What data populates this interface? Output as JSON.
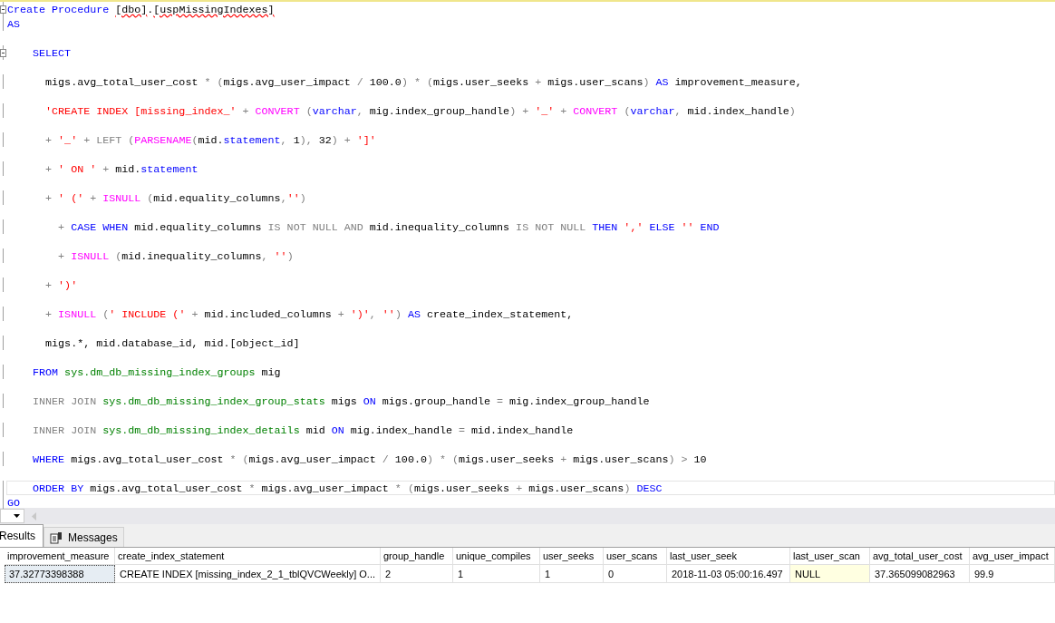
{
  "editor": {
    "lines": [
      {
        "collapsible": true,
        "blank_before": false,
        "current": false,
        "tokens": [
          {
            "kind": "keyword",
            "text": "Create Procedure "
          },
          {
            "kind": "error",
            "text": "[dbo]"
          },
          {
            "kind": "plain",
            "text": "."
          },
          {
            "kind": "error",
            "text": "[uspMissingIndexes]"
          }
        ]
      },
      {
        "collapsible": false,
        "blank_before": false,
        "current": false,
        "tokens": [
          {
            "kind": "keyword",
            "text": "AS"
          }
        ]
      },
      {
        "collapsible": true,
        "blank_before": true,
        "current": false,
        "tokens": [
          {
            "kind": "keyword",
            "text": "    SELECT"
          }
        ]
      },
      {
        "collapsible": false,
        "blank_before": true,
        "current": false,
        "tokens": [
          {
            "kind": "plain",
            "text": "      migs.avg_total_user_cost "
          },
          {
            "kind": "gray",
            "text": "* ("
          },
          {
            "kind": "plain",
            "text": "migs.avg_user_impact "
          },
          {
            "kind": "gray",
            "text": "/"
          },
          {
            "kind": "plain",
            "text": " 100.0"
          },
          {
            "kind": "gray",
            "text": ") * ("
          },
          {
            "kind": "plain",
            "text": "migs.user_seeks "
          },
          {
            "kind": "gray",
            "text": "+"
          },
          {
            "kind": "plain",
            "text": " migs.user_scans"
          },
          {
            "kind": "gray",
            "text": ")"
          },
          {
            "kind": "keyword",
            "text": " AS"
          },
          {
            "kind": "plain",
            "text": " improvement_measure,"
          }
        ]
      },
      {
        "collapsible": false,
        "blank_before": true,
        "current": false,
        "tokens": [
          {
            "kind": "string",
            "text": "      'CREATE INDEX [missing_index_'"
          },
          {
            "kind": "gray",
            "text": " +"
          },
          {
            "kind": "function",
            "text": " CONVERT"
          },
          {
            "kind": "gray",
            "text": " ("
          },
          {
            "kind": "keyword",
            "text": "varchar"
          },
          {
            "kind": "gray",
            "text": ","
          },
          {
            "kind": "plain",
            "text": " mig.index_group_handle"
          },
          {
            "kind": "gray",
            "text": ") +"
          },
          {
            "kind": "string",
            "text": " '_'"
          },
          {
            "kind": "gray",
            "text": " +"
          },
          {
            "kind": "function",
            "text": " CONVERT"
          },
          {
            "kind": "gray",
            "text": " ("
          },
          {
            "kind": "keyword",
            "text": "varchar"
          },
          {
            "kind": "gray",
            "text": ","
          },
          {
            "kind": "plain",
            "text": " mid.index_handle"
          },
          {
            "kind": "gray",
            "text": ")"
          }
        ]
      },
      {
        "collapsible": false,
        "blank_before": true,
        "current": false,
        "tokens": [
          {
            "kind": "gray",
            "text": "      + "
          },
          {
            "kind": "string",
            "text": "'_'"
          },
          {
            "kind": "gray",
            "text": " + LEFT ("
          },
          {
            "kind": "function",
            "text": "PARSENAME"
          },
          {
            "kind": "gray",
            "text": "("
          },
          {
            "kind": "plain",
            "text": "mid."
          },
          {
            "kind": "keyword",
            "text": "statement"
          },
          {
            "kind": "gray",
            "text": ","
          },
          {
            "kind": "plain",
            "text": " 1"
          },
          {
            "kind": "gray",
            "text": "),"
          },
          {
            "kind": "plain",
            "text": " 32"
          },
          {
            "kind": "gray",
            "text": ") +"
          },
          {
            "kind": "string",
            "text": " ']'"
          }
        ]
      },
      {
        "collapsible": false,
        "blank_before": true,
        "current": false,
        "tokens": [
          {
            "kind": "gray",
            "text": "      + "
          },
          {
            "kind": "string",
            "text": "' ON '"
          },
          {
            "kind": "gray",
            "text": " +"
          },
          {
            "kind": "plain",
            "text": " mid."
          },
          {
            "kind": "keyword",
            "text": "statement"
          }
        ]
      },
      {
        "collapsible": false,
        "blank_before": true,
        "current": false,
        "tokens": [
          {
            "kind": "gray",
            "text": "      + "
          },
          {
            "kind": "string",
            "text": "' ('"
          },
          {
            "kind": "gray",
            "text": " + "
          },
          {
            "kind": "function",
            "text": "ISNULL"
          },
          {
            "kind": "gray",
            "text": " ("
          },
          {
            "kind": "plain",
            "text": "mid.equality_columns"
          },
          {
            "kind": "gray",
            "text": ","
          },
          {
            "kind": "string",
            "text": "''"
          },
          {
            "kind": "gray",
            "text": ")"
          }
        ]
      },
      {
        "collapsible": false,
        "blank_before": true,
        "current": false,
        "tokens": [
          {
            "kind": "gray",
            "text": "        + "
          },
          {
            "kind": "keyword",
            "text": "CASE WHEN"
          },
          {
            "kind": "plain",
            "text": " mid.equality_columns"
          },
          {
            "kind": "gray",
            "text": " IS NOT NULL AND"
          },
          {
            "kind": "plain",
            "text": " mid.inequality_columns"
          },
          {
            "kind": "gray",
            "text": " IS NOT NULL"
          },
          {
            "kind": "keyword",
            "text": " THEN"
          },
          {
            "kind": "string",
            "text": " ','"
          },
          {
            "kind": "keyword",
            "text": " ELSE"
          },
          {
            "kind": "string",
            "text": " ''"
          },
          {
            "kind": "keyword",
            "text": " END"
          }
        ]
      },
      {
        "collapsible": false,
        "blank_before": true,
        "current": false,
        "tokens": [
          {
            "kind": "gray",
            "text": "        + "
          },
          {
            "kind": "function",
            "text": "ISNULL"
          },
          {
            "kind": "gray",
            "text": " ("
          },
          {
            "kind": "plain",
            "text": "mid.inequality_columns"
          },
          {
            "kind": "gray",
            "text": ","
          },
          {
            "kind": "string",
            "text": " ''"
          },
          {
            "kind": "gray",
            "text": ")"
          }
        ]
      },
      {
        "collapsible": false,
        "blank_before": true,
        "current": false,
        "tokens": [
          {
            "kind": "gray",
            "text": "      + "
          },
          {
            "kind": "string",
            "text": "')'"
          }
        ]
      },
      {
        "collapsible": false,
        "blank_before": true,
        "current": false,
        "tokens": [
          {
            "kind": "gray",
            "text": "      + "
          },
          {
            "kind": "function",
            "text": "ISNULL"
          },
          {
            "kind": "gray",
            "text": " ("
          },
          {
            "kind": "string",
            "text": "' INCLUDE ('"
          },
          {
            "kind": "gray",
            "text": " +"
          },
          {
            "kind": "plain",
            "text": " mid.included_columns"
          },
          {
            "kind": "gray",
            "text": " +"
          },
          {
            "kind": "string",
            "text": " ')'"
          },
          {
            "kind": "gray",
            "text": ","
          },
          {
            "kind": "string",
            "text": " ''"
          },
          {
            "kind": "gray",
            "text": ")"
          },
          {
            "kind": "keyword",
            "text": " AS"
          },
          {
            "kind": "plain",
            "text": " create_index_statement,"
          }
        ]
      },
      {
        "collapsible": false,
        "blank_before": true,
        "current": false,
        "tokens": [
          {
            "kind": "plain",
            "text": "      migs.*, mid.database_id, mid.[object_id]"
          }
        ]
      },
      {
        "collapsible": false,
        "blank_before": true,
        "current": false,
        "tokens": [
          {
            "kind": "keyword",
            "text": "    FROM"
          },
          {
            "kind": "system",
            "text": " sys.dm_db_missing_index_groups"
          },
          {
            "kind": "plain",
            "text": " mig"
          }
        ]
      },
      {
        "collapsible": false,
        "blank_before": true,
        "current": false,
        "tokens": [
          {
            "kind": "gray",
            "text": "    INNER JOIN"
          },
          {
            "kind": "system",
            "text": " sys.dm_db_missing_index_group_stats"
          },
          {
            "kind": "plain",
            "text": " migs"
          },
          {
            "kind": "keyword",
            "text": " ON"
          },
          {
            "kind": "plain",
            "text": " migs.group_handle"
          },
          {
            "kind": "gray",
            "text": " ="
          },
          {
            "kind": "plain",
            "text": " mig.index_group_handle"
          }
        ]
      },
      {
        "collapsible": false,
        "blank_before": true,
        "current": false,
        "tokens": [
          {
            "kind": "gray",
            "text": "    INNER JOIN"
          },
          {
            "kind": "system",
            "text": " sys.dm_db_missing_index_details"
          },
          {
            "kind": "plain",
            "text": " mid"
          },
          {
            "kind": "keyword",
            "text": " ON"
          },
          {
            "kind": "plain",
            "text": " mig.index_handle"
          },
          {
            "kind": "gray",
            "text": " ="
          },
          {
            "kind": "plain",
            "text": " mid.index_handle"
          }
        ]
      },
      {
        "collapsible": false,
        "blank_before": true,
        "current": false,
        "tokens": [
          {
            "kind": "keyword",
            "text": "    WHERE"
          },
          {
            "kind": "plain",
            "text": " migs.avg_total_user_cost"
          },
          {
            "kind": "gray",
            "text": " * ("
          },
          {
            "kind": "plain",
            "text": "migs.avg_user_impact"
          },
          {
            "kind": "gray",
            "text": " /"
          },
          {
            "kind": "plain",
            "text": " 100.0"
          },
          {
            "kind": "gray",
            "text": ") * ("
          },
          {
            "kind": "plain",
            "text": "migs.user_seeks"
          },
          {
            "kind": "gray",
            "text": " +"
          },
          {
            "kind": "plain",
            "text": " migs.user_scans"
          },
          {
            "kind": "gray",
            "text": ") >"
          },
          {
            "kind": "plain",
            "text": " 10"
          }
        ]
      },
      {
        "collapsible": false,
        "blank_before": true,
        "current": true,
        "tokens": [
          {
            "kind": "keyword",
            "text": "    ORDER BY"
          },
          {
            "kind": "plain",
            "text": " migs.avg_total_user_cost"
          },
          {
            "kind": "gray",
            "text": " *"
          },
          {
            "kind": "plain",
            "text": " migs.avg_user_impact"
          },
          {
            "kind": "gray",
            "text": " * ("
          },
          {
            "kind": "plain",
            "text": "migs.user_seeks"
          },
          {
            "kind": "gray",
            "text": " +"
          },
          {
            "kind": "plain",
            "text": " migs.user_scans"
          },
          {
            "kind": "gray",
            "text": ")"
          },
          {
            "kind": "keyword",
            "text": " DESC"
          }
        ]
      },
      {
        "collapsible": false,
        "blank_before": false,
        "current": false,
        "tokens": [
          {
            "kind": "keyword",
            "text": "GO"
          }
        ]
      }
    ]
  },
  "result_tabs": [
    {
      "label": "Results",
      "selected": true
    },
    {
      "label": "Messages",
      "selected": false
    }
  ],
  "grid": {
    "columns": [
      "improvement_measure",
      "create_index_statement",
      "group_handle",
      "unique_compiles",
      "user_seeks",
      "user_scans",
      "last_user_seek",
      "last_user_scan",
      "avg_total_user_cost",
      "avg_user_impact"
    ],
    "rows": [
      [
        {
          "text": "37.32773398388",
          "selected": true,
          "kind": "value"
        },
        {
          "text": "CREATE INDEX [missing_index_2_1_tblQVCWeekly] O...",
          "selected": false,
          "kind": "value"
        },
        {
          "text": "2",
          "selected": false,
          "kind": "value"
        },
        {
          "text": "1",
          "selected": false,
          "kind": "value"
        },
        {
          "text": "1",
          "selected": false,
          "kind": "value"
        },
        {
          "text": "0",
          "selected": false,
          "kind": "value"
        },
        {
          "text": "2018-11-03 05:00:16.497",
          "selected": false,
          "kind": "value"
        },
        {
          "text": "NULL",
          "selected": false,
          "kind": "null"
        },
        {
          "text": "37.365099082963",
          "selected": false,
          "kind": "value"
        },
        {
          "text": "99.9",
          "selected": false,
          "kind": "value"
        }
      ]
    ]
  }
}
